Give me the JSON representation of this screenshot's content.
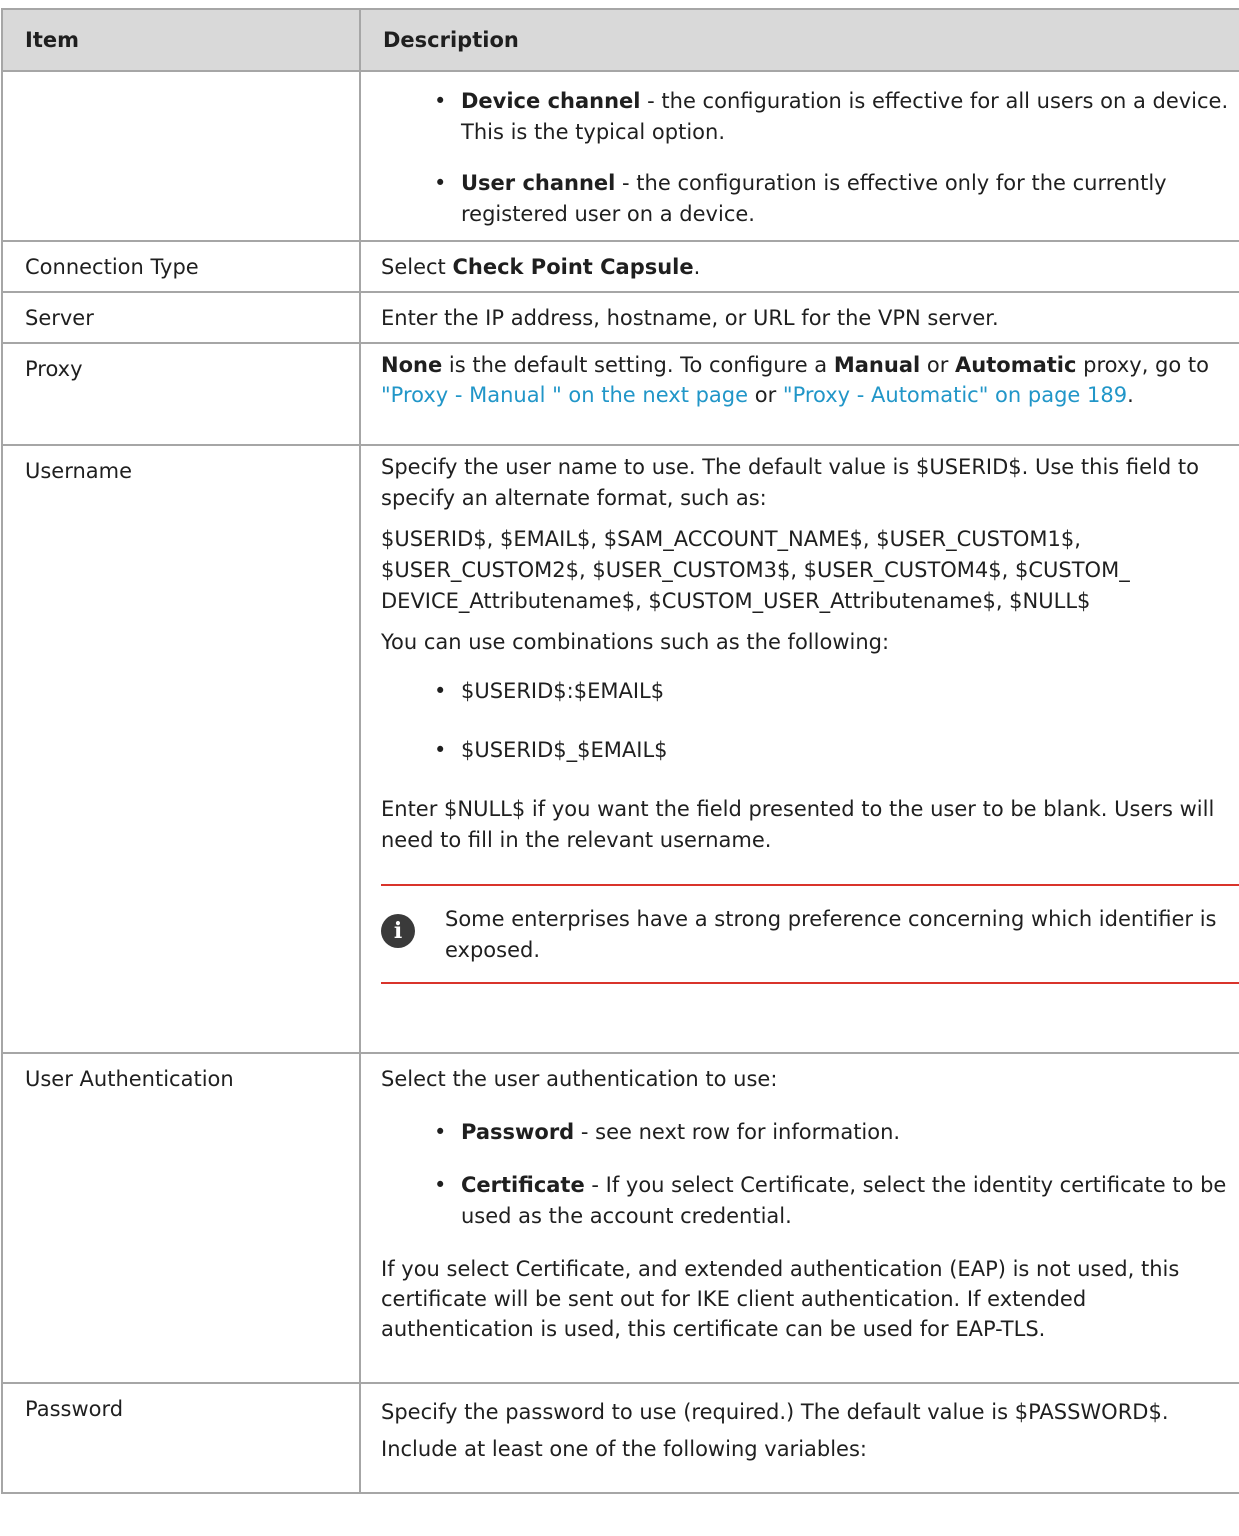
{
  "header": {
    "item": "Item",
    "description": "Description"
  },
  "channel_row": {
    "bullets": [
      {
        "bold": "Device channel",
        "text": " - the configuration is effective for all users on a device. This is the typical option."
      },
      {
        "bold": "User channel",
        "text": " - the configuration is effective only for the currently registered user on a device."
      }
    ]
  },
  "connection_type": {
    "item": "Connection Type",
    "pre": "Select ",
    "bold": "Check Point Capsule",
    "post": "."
  },
  "server": {
    "item": "Server",
    "text": "Enter the IP address, hostname, or URL for the VPN server."
  },
  "proxy": {
    "item": "Proxy",
    "bold_none": "None",
    "t1": " is the default setting. To configure a ",
    "bold_manual": "Manual",
    "t2": " or ",
    "bold_auto": "Automatic",
    "t3": " proxy, go to ",
    "link1": "\"Proxy - Manual \" on the next page",
    "t4": " or ",
    "link2": "\"Proxy - Automatic\" on page 189",
    "t5": "."
  },
  "username": {
    "item": "Username",
    "p1": "Specify the user name to use. The default value is $USERID$. Use this field to specify an alternate format, such as:",
    "p2": "$USERID$, $EMAIL$, $SAM_ACCOUNT_NAME$, $USER_CUSTOM1$, $USER_CUSTOM2$, $USER_CUSTOM3$, $USER_CUSTOM4$, $CUSTOM_ DEVICE_Attributename$, $CUSTOM_USER_Attributename$, $NULL$",
    "p3": "You can use combinations such as the following:",
    "combos": [
      "$USERID$:$EMAIL$",
      "$USERID$_$EMAIL$"
    ],
    "p4": "Enter $NULL$ if you want the field presented to the user to be blank. Users will need to fill in the relevant username.",
    "note": "Some enterprises have a strong preference concerning which identifier is exposed."
  },
  "user_auth": {
    "item": "User Authentication",
    "p1": "Select the user authentication to use:",
    "bullets": [
      {
        "bold": "Password",
        "text": " - see next row for information."
      },
      {
        "bold": "Certificate",
        "text": " - If you select Certificate, select the identity certificate to be used as the account credential."
      }
    ],
    "p2": "If you select Certificate, and extended authentication (EAP) is not used, this certificate will be sent out for IKE client authentication. If extended authentication is used, this certificate can be used for EAP-TLS."
  },
  "password": {
    "item": "Password",
    "p1": "Specify the password to use (required.) The default value is $PASSWORD$. Include at least one of the following variables:"
  },
  "colors": {
    "link": "#2196c8",
    "note_rule": "#d9342b",
    "header_bg": "#d9d9d9",
    "border": "#a6a6a6"
  },
  "icons": {
    "note": "info-icon"
  }
}
